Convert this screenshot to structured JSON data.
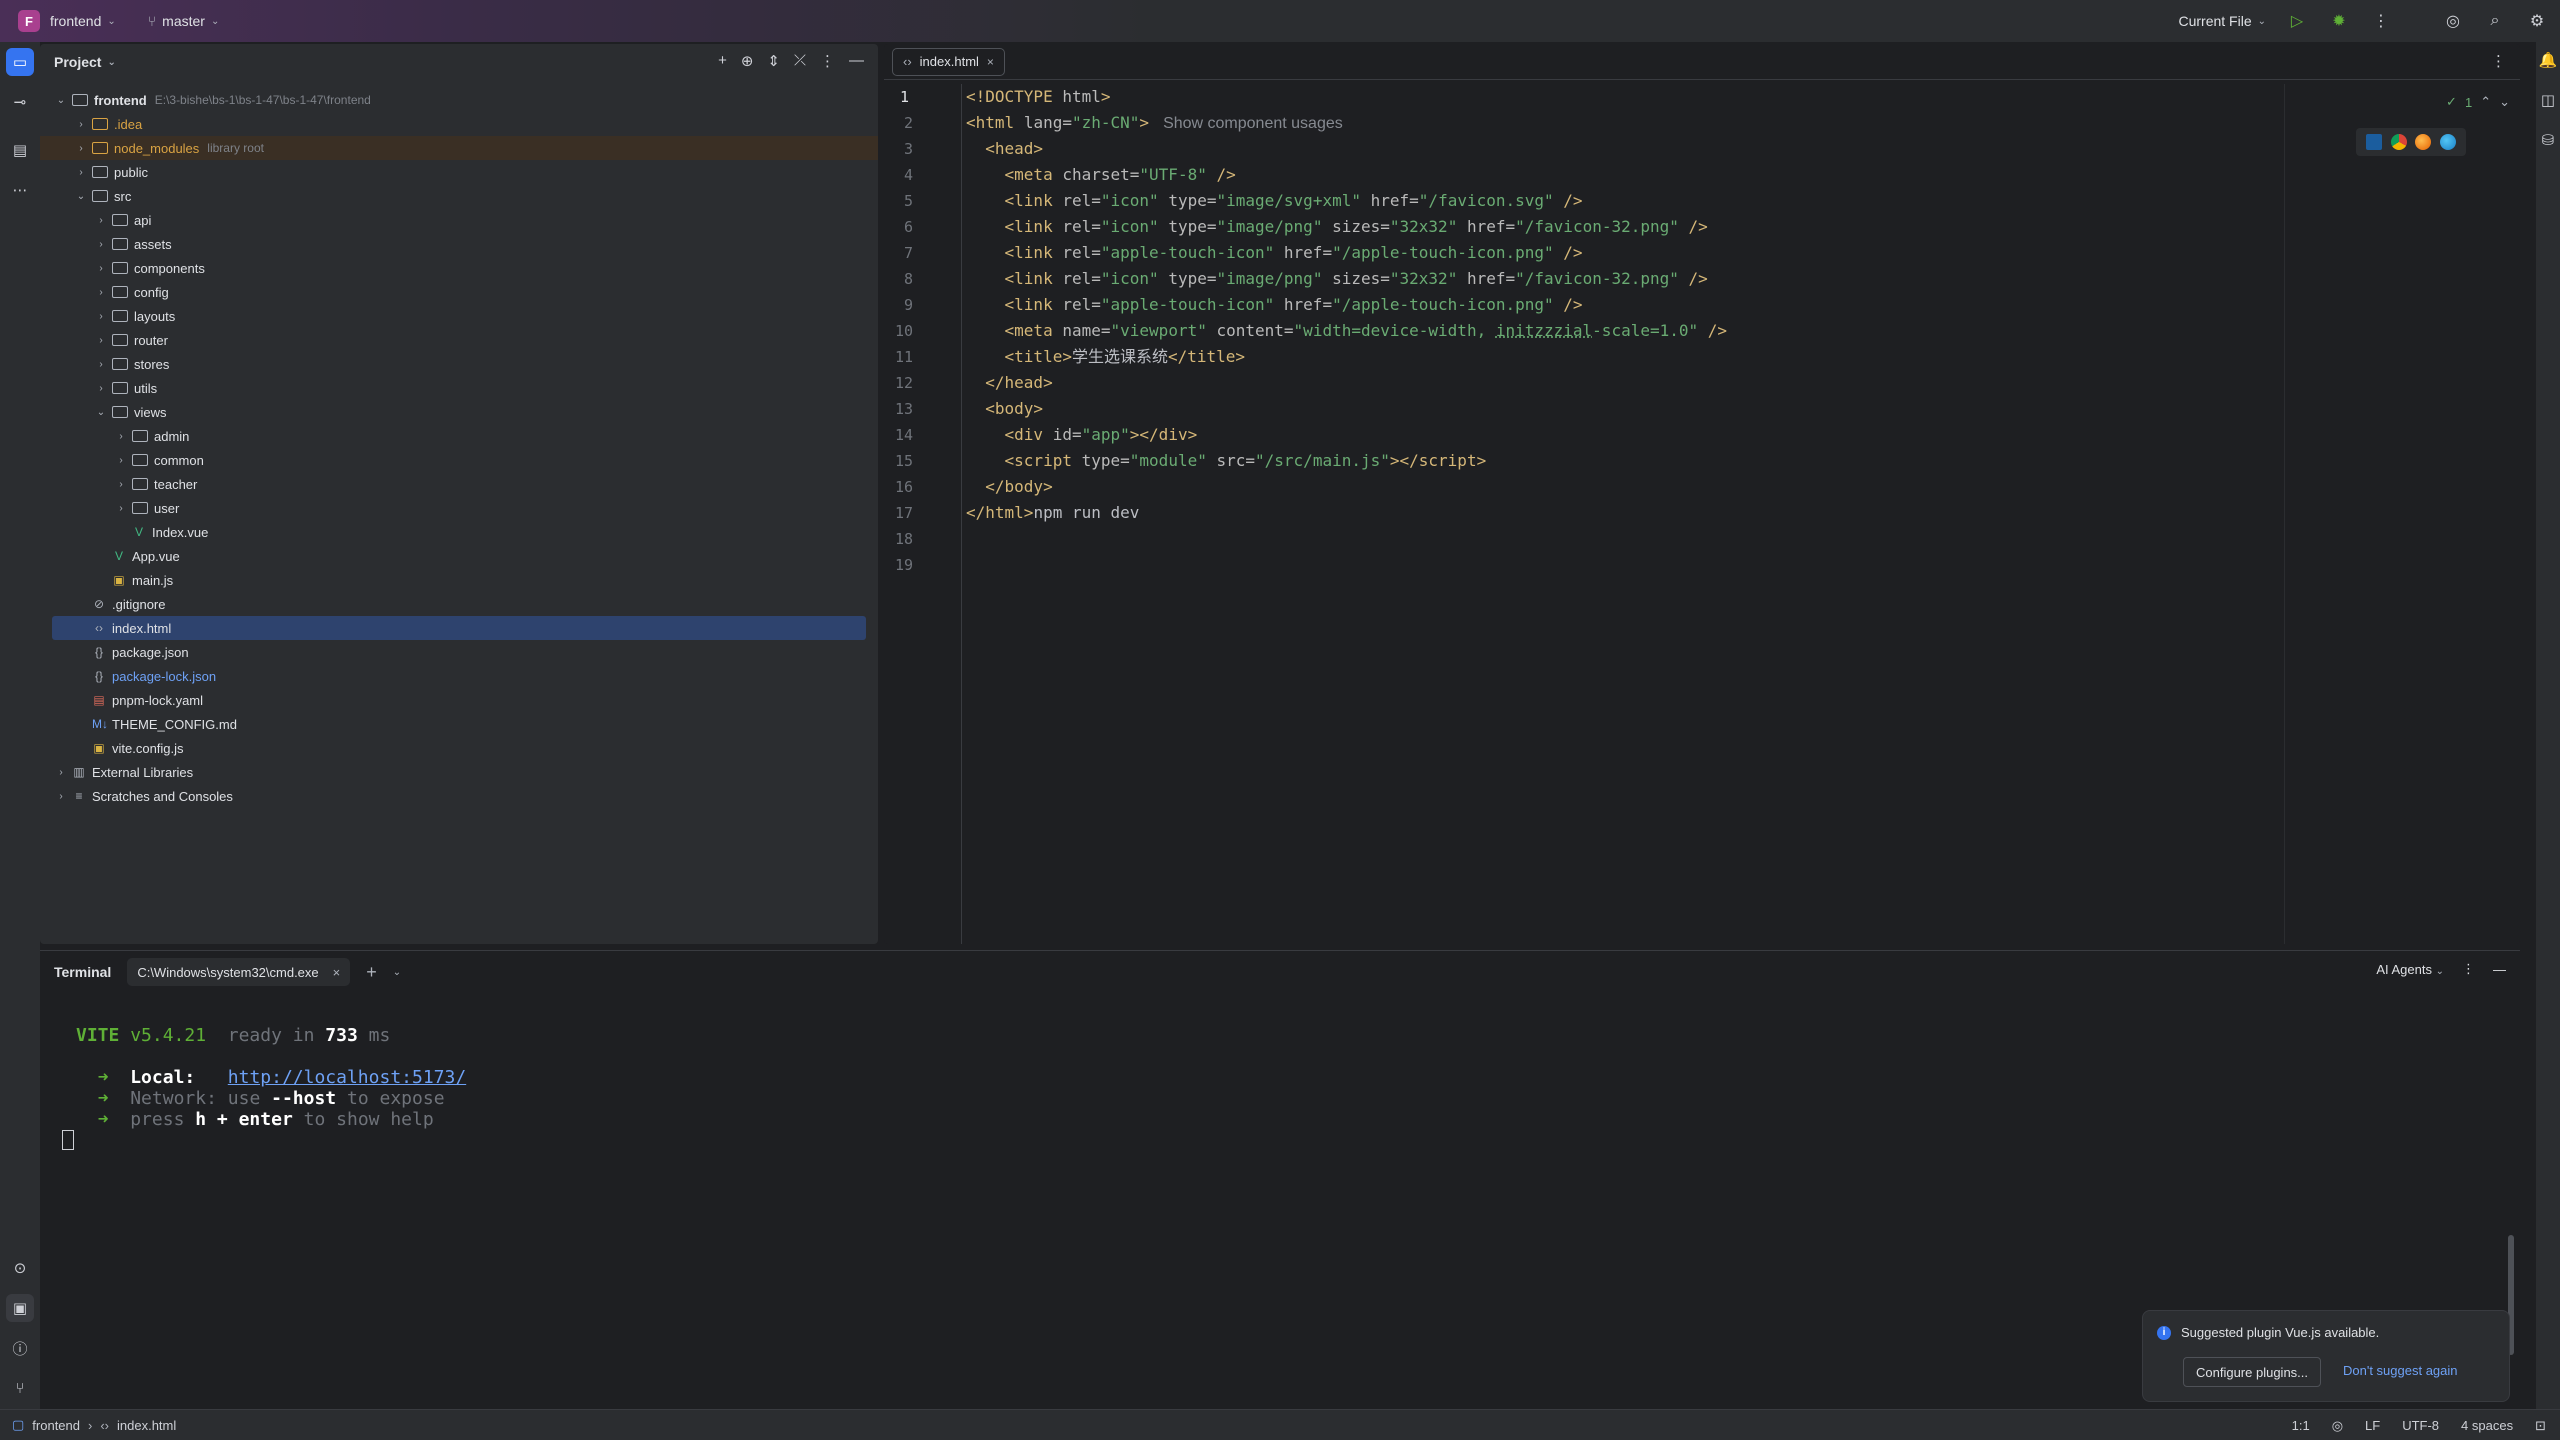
{
  "titlebar": {
    "project_letter": "F",
    "project_name": "frontend",
    "branch": "master",
    "run_config": "Current File"
  },
  "project_panel": {
    "title": "Project",
    "root": {
      "name": "frontend",
      "path": "E:\\3-bishe\\bs-1\\bs-1-47\\bs-1-47\\frontend"
    },
    "items": [
      {
        "name": ".idea",
        "hint": ""
      },
      {
        "name": "node_modules",
        "hint": "library root"
      },
      {
        "name": "public",
        "hint": ""
      },
      {
        "name": "src",
        "hint": ""
      },
      {
        "name": "api"
      },
      {
        "name": "assets"
      },
      {
        "name": "components"
      },
      {
        "name": "config"
      },
      {
        "name": "layouts"
      },
      {
        "name": "router"
      },
      {
        "name": "stores"
      },
      {
        "name": "utils"
      },
      {
        "name": "views"
      },
      {
        "name": "admin"
      },
      {
        "name": "common"
      },
      {
        "name": "teacher"
      },
      {
        "name": "user"
      },
      {
        "name": "Index.vue"
      },
      {
        "name": "App.vue"
      },
      {
        "name": "main.js"
      },
      {
        "name": ".gitignore"
      },
      {
        "name": "index.html"
      },
      {
        "name": "package.json"
      },
      {
        "name": "package-lock.json"
      },
      {
        "name": "pnpm-lock.yaml"
      },
      {
        "name": "THEME_CONFIG.md"
      },
      {
        "name": "vite.config.js"
      },
      {
        "name": "External Libraries"
      },
      {
        "name": "Scratches and Consoles"
      }
    ]
  },
  "editor": {
    "tab": "index.html",
    "inspection_count": "1",
    "inlay_hint": "Show component usages",
    "line_numbers": [
      "1",
      "2",
      "3",
      "4",
      "5",
      "6",
      "7",
      "8",
      "9",
      "10",
      "11",
      "12",
      "13",
      "14",
      "15",
      "16",
      "17",
      "18",
      "19"
    ]
  },
  "terminal": {
    "title": "Terminal",
    "tab": "C:\\Windows\\system32\\cmd.exe",
    "ai_agents": "AI Agents",
    "vite_label": "VITE",
    "vite_version": "v5.4.21",
    "ready_text": "ready in",
    "ready_ms": "733",
    "ms_unit": "ms",
    "local_label": "Local:",
    "local_url": "http://localhost:5173/",
    "network_label": "Network:",
    "network_use": "use",
    "network_flag": "--host",
    "network_rest": "to expose",
    "press_text": "press",
    "help_keys": "h + enter",
    "help_rest": "to show help",
    "arrow": "➜"
  },
  "notification": {
    "message": "Suggested plugin Vue.js available.",
    "configure_btn": "Configure plugins...",
    "dismiss_link": "Don't suggest again"
  },
  "statusbar": {
    "crumb_project": "frontend",
    "crumb_file": "index.html",
    "position": "1:1",
    "line_sep": "LF",
    "encoding": "UTF-8",
    "indent": "4 spaces"
  },
  "colors": {
    "accent": "#3574f0",
    "vite_green": "#5fb036",
    "string_green": "#6aab73",
    "tag_yellow": "#d5b778"
  }
}
